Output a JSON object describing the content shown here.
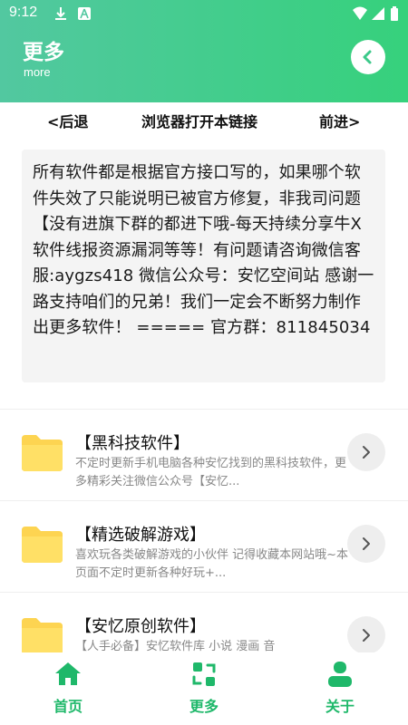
{
  "status": {
    "time": "9:12"
  },
  "header": {
    "title": "更多",
    "subtitle": "more"
  },
  "nav": {
    "back": "<后退",
    "open_browser": "浏览器打开本链接",
    "forward": "前进>"
  },
  "notice": {
    "text": "所有软件都是根据官方接口写的，如果哪个软件失效了只能说明已被官方修复，非我司问题【没有进旗下群的都进下哦-每天持续分享牛X软件线报资源漏洞等等！有问题请咨询微信客服:aygzs418 微信公众号：安忆空间站 感谢一路支持咱们的兄弟！我们一定会不断努力制作出更多软件！ ===== 官方群：811845034"
  },
  "list": [
    {
      "title": "【黑科技软件】",
      "desc": "不定时更新手机电脑各种安忆找到的黑科技软件，更多精彩关注微信公众号【安忆..."
    },
    {
      "title": "【精选破解游戏】",
      "desc": "喜欢玩各类破解游戏的小伙伴 记得收藏本网站哦~本页面不定时更新各种好玩+..."
    },
    {
      "title": "【安忆原创软件】",
      "desc": "【人手必备】安忆软件库   小说  漫画  音"
    }
  ],
  "tabs": [
    {
      "label": "首页",
      "icon": "home-icon"
    },
    {
      "label": "更多",
      "icon": "more-icon"
    },
    {
      "label": "关于",
      "icon": "user-icon"
    }
  ],
  "colors": {
    "accent": "#1fb86a",
    "header_start": "#52c8a0",
    "header_end": "#36d17c",
    "folder": "#fdd451"
  }
}
